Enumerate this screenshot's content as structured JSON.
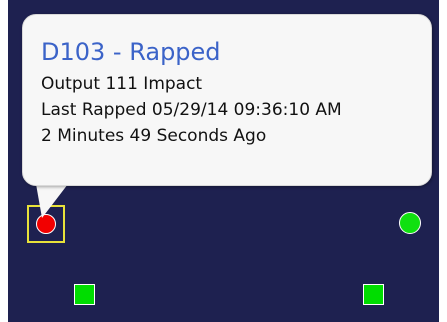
{
  "tooltip": {
    "title": "D103 - Rapped",
    "lines": [
      "Output 111 Impact",
      "Last Rapped 05/29/14 09:36:10 AM",
      "2 Minutes 49 Seconds Ago"
    ]
  },
  "colors": {
    "panel_background": "#1e2150",
    "tooltip_title": "#3b63c8",
    "status_rapped": "#f20000",
    "status_ok": "#10e010",
    "selection_outline": "#e8e23a"
  },
  "devices": [
    {
      "shape": "circle",
      "status": "rapped",
      "selected": true
    },
    {
      "shape": "circle",
      "status": "ok",
      "selected": false
    },
    {
      "shape": "square",
      "status": "ok",
      "selected": false
    },
    {
      "shape": "square",
      "status": "ok",
      "selected": false
    }
  ]
}
